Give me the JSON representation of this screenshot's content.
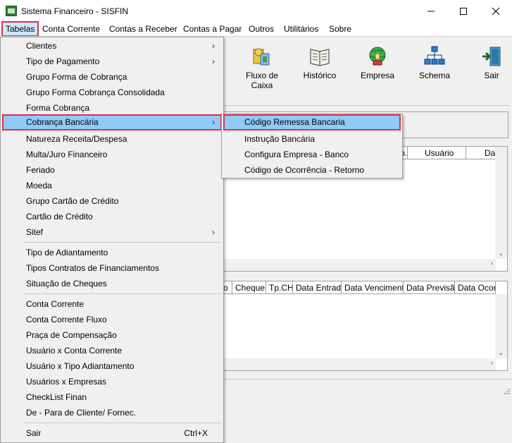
{
  "window": {
    "title": "Sistema Financeiro - SISFIN",
    "minimize": "—",
    "maximize": "☐",
    "close": "✕"
  },
  "menubar": {
    "items": [
      "Tabelas",
      "Conta Corrente",
      "Contas a Receber",
      "Contas a Pagar",
      "Outros",
      "Utilitários",
      "Sobre"
    ],
    "active": "Tabelas"
  },
  "toolbar": {
    "buttons": [
      {
        "label": "Fluxo de Caixa",
        "icon": "cash-flow-icon"
      },
      {
        "label": "Histórico",
        "icon": "history-book-icon"
      },
      {
        "label": "Empresa",
        "icon": "company-globe-icon"
      },
      {
        "label": "Schema",
        "icon": "schema-network-icon"
      },
      {
        "label": "Sair",
        "icon": "exit-door-icon"
      }
    ]
  },
  "grid_top": {
    "columns": [
      "o.",
      "Usuário",
      "Da"
    ]
  },
  "grid_bottom": {
    "columns": [
      "o",
      "Cheque",
      "Tp.CH",
      "Data Entrada",
      "Data Vencimento",
      "Data Previsão",
      "Data Ocorrê"
    ]
  },
  "dropdown": {
    "items": [
      {
        "label": "Clientes",
        "submenu": true
      },
      {
        "label": "Tipo de Pagamento",
        "submenu": true
      },
      {
        "label": "Grupo Forma de Cobrança"
      },
      {
        "label": "Grupo Forma Cobrança Consolidada"
      },
      {
        "label": "Forma Cobrança"
      },
      {
        "label": "Cobrança Bancária",
        "submenu": true,
        "highlighted": true
      },
      {
        "label": "Natureza Receita/Despesa"
      },
      {
        "label": "Multa/Juro Financeiro"
      },
      {
        "label": "Feriado"
      },
      {
        "label": "Moeda"
      },
      {
        "label": "Grupo Cartão de Crédito"
      },
      {
        "label": "Cartão de Crédito"
      },
      {
        "label": "Sitef",
        "submenu": true
      },
      {
        "label": "Tipo de Adiantamento"
      },
      {
        "label": "Tipos Contratos de Financiamentos"
      },
      {
        "label": "Situação de Cheques"
      },
      {
        "label": "Conta Corrente"
      },
      {
        "label": "Conta Corrente Fluxo"
      },
      {
        "label": "Praça de Compensação"
      },
      {
        "label": "Usuário x Conta Corrente"
      },
      {
        "label": "Usuário x Tipo Adiantamento"
      },
      {
        "label": "Usuários x Empresas"
      },
      {
        "label": "CheckList Finan"
      },
      {
        "label": "De - Para de Cliente/ Fornec."
      },
      {
        "label": "Sair",
        "shortcut": "Ctrl+X"
      }
    ],
    "submenu_arrow": "›"
  },
  "submenu": {
    "items": [
      {
        "label": "Código Remessa Bancaria",
        "highlighted": true
      },
      {
        "label": "Instrução Bancária"
      },
      {
        "label": "Configura Empresa - Banco"
      },
      {
        "label": "Código de Ocorrência - Retorno"
      }
    ]
  },
  "colors": {
    "highlight": "#91c9f7",
    "focus_border": "#d9324a",
    "menu_active": "#cce8ff"
  }
}
